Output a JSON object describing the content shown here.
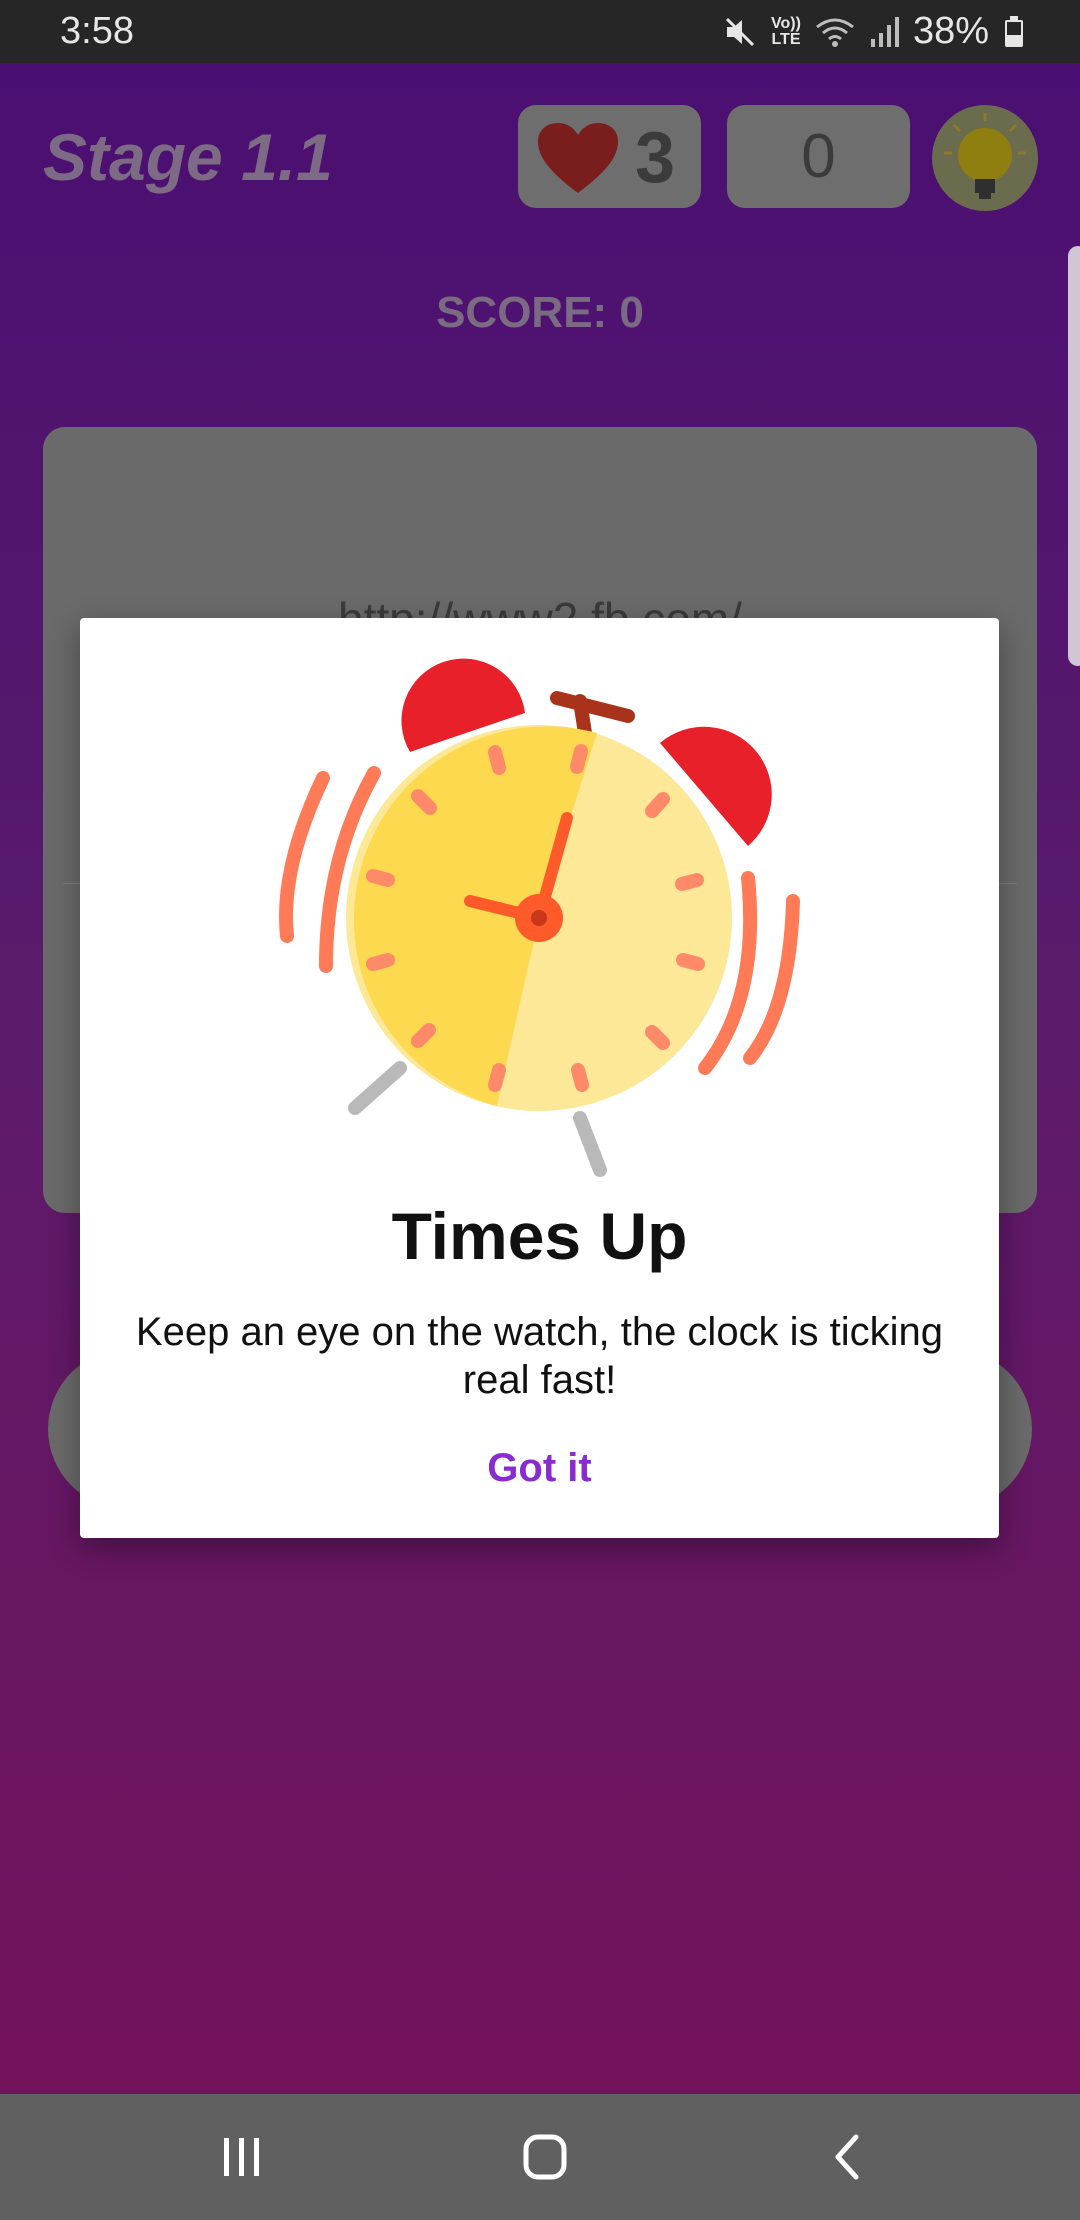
{
  "status_bar": {
    "time": "3:58",
    "volte": "Vo))",
    "lte": "LTE",
    "battery": "38%"
  },
  "header": {
    "stage": "Stage 1.1",
    "lives": "3",
    "counter": "0"
  },
  "score": "SCORE: 0",
  "card": {
    "url": "http://www2.fb.com/"
  },
  "dialog": {
    "title": "Times Up",
    "body": "Keep an eye on the watch, the clock is ticking real fast!",
    "button": "Got it"
  },
  "icons": {
    "heart": "heart-icon",
    "hint": "lightbulb-icon",
    "mute": "mute-icon",
    "wifi": "wifi-icon",
    "signal": "signal-icon",
    "battery": "battery-icon",
    "alarm": "alarm-clock-icon"
  },
  "colors": {
    "accent": "#8a2bcf",
    "heart": "#7a1d1d",
    "clock_face": "#fde08a",
    "clock_bells": "#e8202a"
  }
}
